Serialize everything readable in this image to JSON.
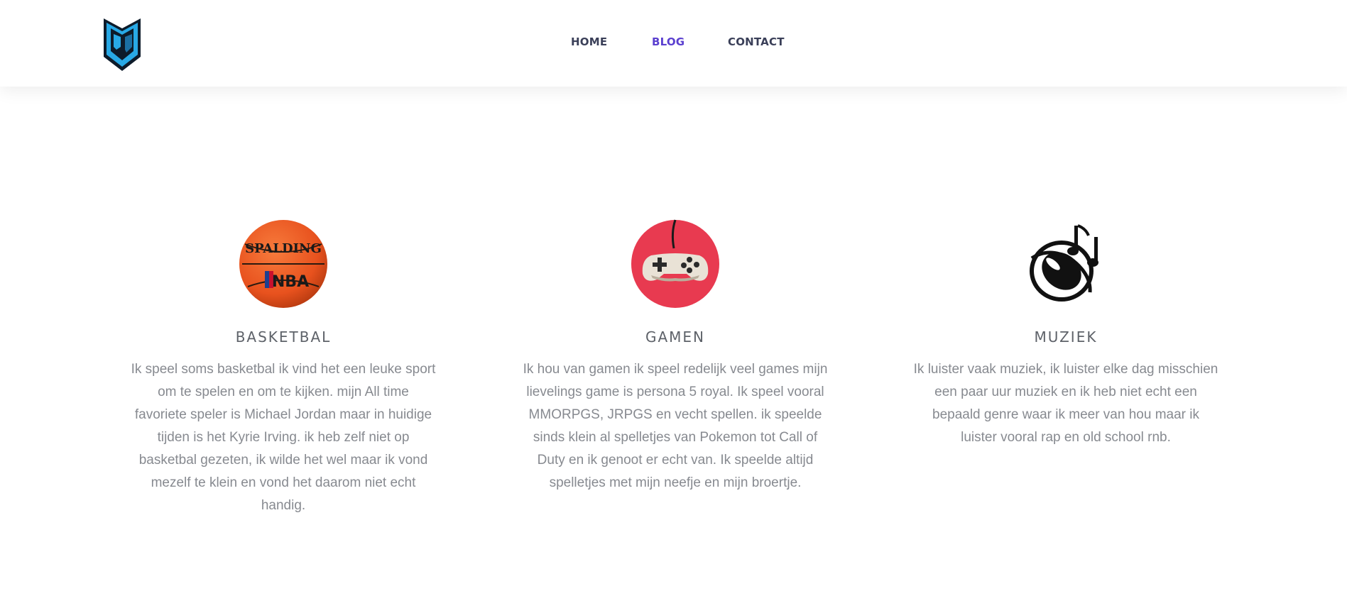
{
  "nav": {
    "home": "HOME",
    "blog": "BLOG",
    "contact": "CONTACT"
  },
  "colors": {
    "accent": "#5a3fcf",
    "nav_text": "#3a3f58",
    "heading": "#5e6269",
    "body_text": "#878a90",
    "logo_blue": "#28a9e6",
    "basketball_orange": "#e8521e",
    "gamepad_red": "#e83a50"
  },
  "cards": [
    {
      "icon": "basketball-icon",
      "icon_text_top": "SPALDING",
      "icon_text_bottom": "NBA",
      "title": "BASKETBAL",
      "text": "Ik speel soms basketbal ik vind het een leuke sport om te spelen en om te kijken. mijn All time favoriete speler is Michael Jordan maar in huidige tijden is het Kyrie Irving. ik heb zelf niet op basketbal gezeten, ik wilde het wel maar ik vond mezelf te klein en vond het daarom niet echt handig."
    },
    {
      "icon": "gamepad-icon",
      "title": "GAMEN",
      "text": "Ik hou van gamen ik speel redelijk veel games mijn lievelings game is persona 5 royal. Ik speel vooral MMORPGS, JRPGS en vecht spellen. ik speelde sinds klein al spelletjes van Pokemon tot Call of Duty en ik genoot er echt van. Ik speelde altijd spelletjes met mijn neefje en mijn broertje."
    },
    {
      "icon": "music-icon",
      "title": "MUZIEK",
      "text": "Ik luister vaak muziek, ik luister elke dag misschien een paar uur muziek en ik heb niet echt een bepaald genre waar ik meer van hou maar ik luister vooral rap en old school rnb."
    }
  ]
}
